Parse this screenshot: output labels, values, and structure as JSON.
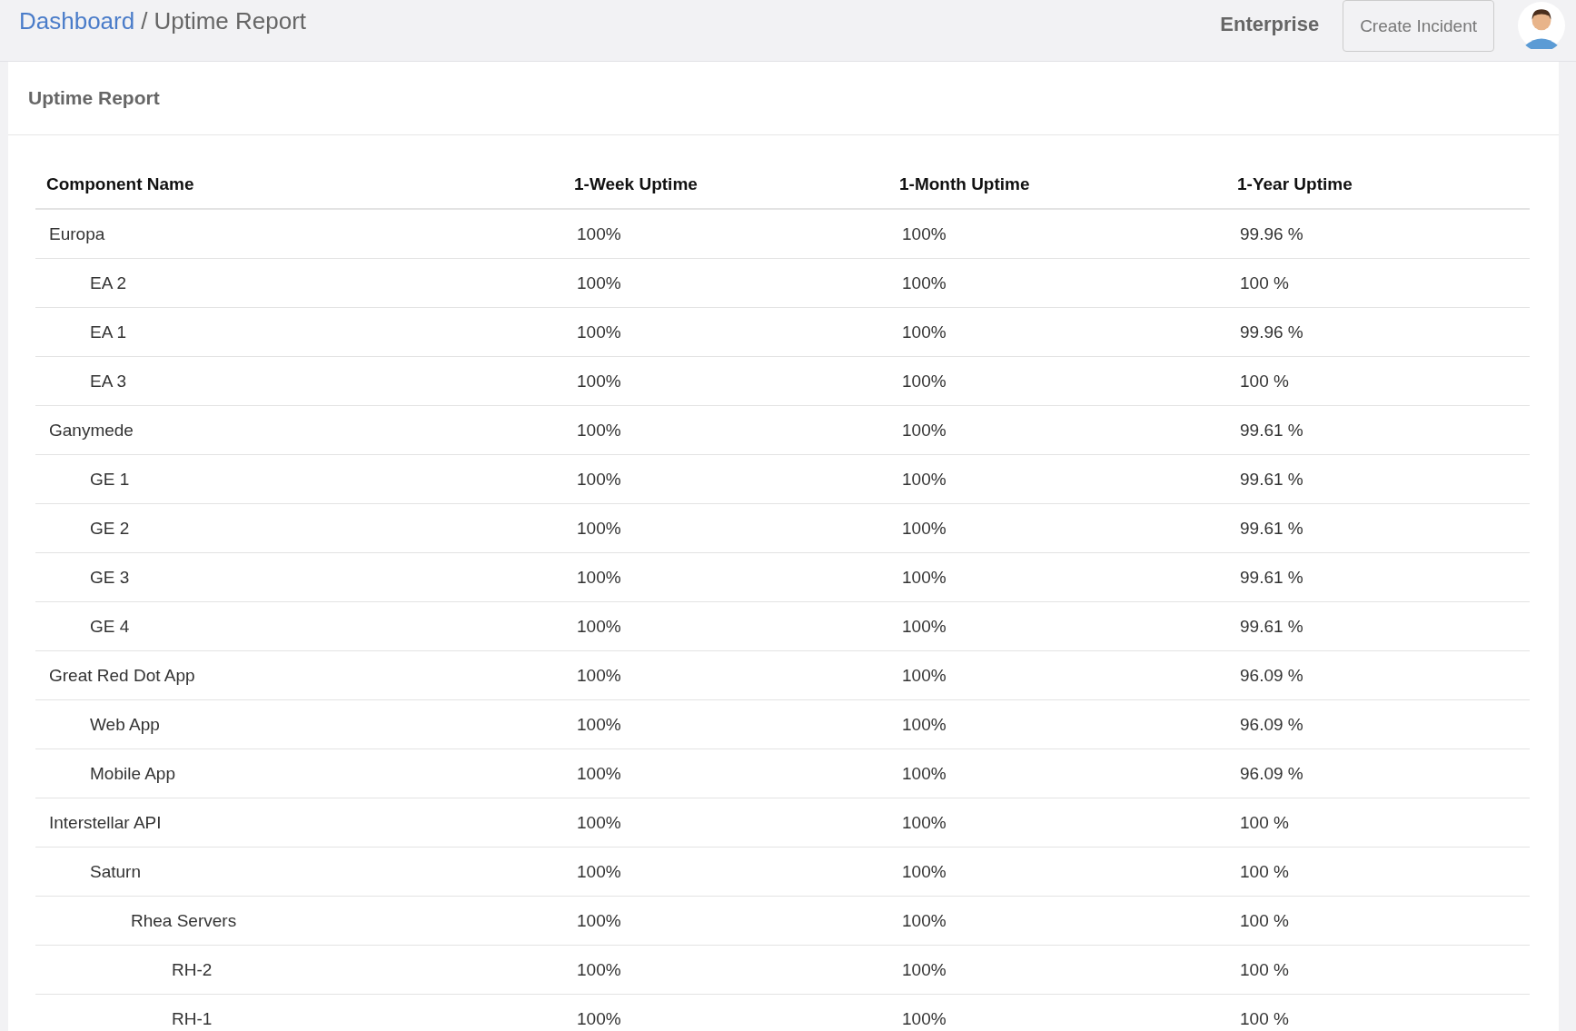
{
  "breadcrumb": {
    "link": "Dashboard",
    "separator": "/",
    "current": "Uptime Report"
  },
  "header": {
    "plan": "Enterprise",
    "button": "Create Incident"
  },
  "card": {
    "title": "Uptime Report"
  },
  "table": {
    "columns": [
      "Component Name",
      "1-Week Uptime",
      "1-Month Uptime",
      "1-Year Uptime"
    ],
    "rows": [
      {
        "name": "Europa",
        "week": "100%",
        "month": "100%",
        "year": "99.96 %",
        "children": [
          {
            "name": "EA 2",
            "week": "100%",
            "month": "100%",
            "year": "100 %"
          },
          {
            "name": "EA 1",
            "week": "100%",
            "month": "100%",
            "year": "99.96 %"
          },
          {
            "name": "EA 3",
            "week": "100%",
            "month": "100%",
            "year": "100 %"
          }
        ]
      },
      {
        "name": "Ganymede",
        "week": "100%",
        "month": "100%",
        "year": "99.61 %",
        "children": [
          {
            "name": "GE 1",
            "week": "100%",
            "month": "100%",
            "year": "99.61 %"
          },
          {
            "name": "GE 2",
            "week": "100%",
            "month": "100%",
            "year": "99.61 %"
          },
          {
            "name": "GE 3",
            "week": "100%",
            "month": "100%",
            "year": "99.61 %"
          },
          {
            "name": "GE 4",
            "week": "100%",
            "month": "100%",
            "year": "99.61 %"
          }
        ]
      },
      {
        "name": "Great Red Dot App",
        "week": "100%",
        "month": "100%",
        "year": "96.09 %",
        "children": [
          {
            "name": "Web App",
            "week": "100%",
            "month": "100%",
            "year": "96.09 %"
          },
          {
            "name": "Mobile App",
            "week": "100%",
            "month": "100%",
            "year": "96.09 %"
          }
        ]
      },
      {
        "name": "Interstellar API",
        "week": "100%",
        "month": "100%",
        "year": "100 %",
        "children": [
          {
            "name": "Saturn",
            "week": "100%",
            "month": "100%",
            "year": "100 %",
            "children": [
              {
                "name": "Rhea Servers",
                "week": "100%",
                "month": "100%",
                "year": "100 %",
                "children": [
                  {
                    "name": "RH-2",
                    "week": "100%",
                    "month": "100%",
                    "year": "100 %"
                  },
                  {
                    "name": "RH-1",
                    "week": "100%",
                    "month": "100%",
                    "year": "100 %"
                  }
                ]
              }
            ]
          }
        ]
      }
    ]
  }
}
